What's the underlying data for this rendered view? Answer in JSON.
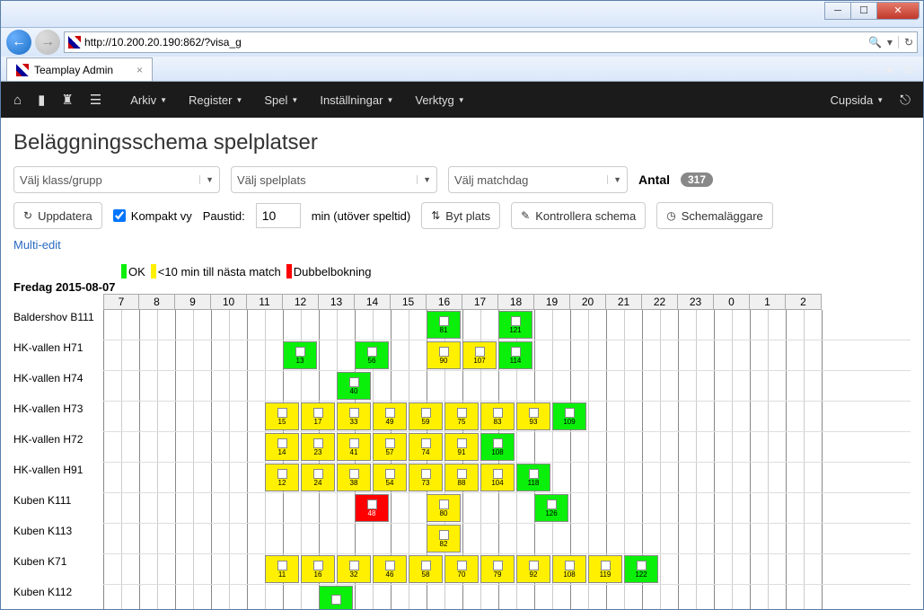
{
  "browser": {
    "url": "http://10.200.20.190:862/?visa_g",
    "tab_title": "Teamplay Admin"
  },
  "nav": {
    "items": [
      "Arkiv",
      "Register",
      "Spel",
      "Inställningar",
      "Verktyg"
    ],
    "right": "Cupsida"
  },
  "page_title": "Beläggningsschema spelplatser",
  "selects": {
    "klass": "Välj klass/grupp",
    "spelplats": "Välj spelplats",
    "matchdag": "Välj matchdag"
  },
  "antal_label": "Antal",
  "antal_value": "317",
  "btn_uppdatera": "Uppdatera",
  "chk_kompakt_label": "Kompakt vy",
  "paustid_label": "Paustid:",
  "paustid_value": "10",
  "paustid_suffix": "min (utöver speltid)",
  "btn_bytplats": "Byt plats",
  "btn_kontrollera": "Kontrollera schema",
  "btn_schemalaggare": "Schemaläggare",
  "link_multiedit": "Multi-edit",
  "legend": {
    "ok": "OK",
    "warn": "<10 min till nästa match",
    "err": "Dubbelbokning"
  },
  "date_label": "Fredag 2015-08-07",
  "hours": [
    "7",
    "8",
    "9",
    "10",
    "11",
    "12",
    "13",
    "14",
    "15",
    "16",
    "17",
    "18",
    "19",
    "20",
    "21",
    "22",
    "23",
    "0",
    "1",
    "2"
  ],
  "rows": [
    {
      "label": "Baldershov B111",
      "blocks": [
        {
          "start": 9,
          "color": "green",
          "num": "81"
        },
        {
          "start": 11,
          "color": "green",
          "num": "121"
        }
      ]
    },
    {
      "label": "HK-vallen H71",
      "blocks": [
        {
          "start": 5,
          "color": "green",
          "num": "13"
        },
        {
          "start": 7,
          "color": "green",
          "num": "56"
        },
        {
          "start": 9,
          "color": "yellow",
          "num": "90"
        },
        {
          "start": 10,
          "color": "yellow",
          "num": "107"
        },
        {
          "start": 11,
          "color": "green",
          "num": "114"
        }
      ]
    },
    {
      "label": "HK-vallen H74",
      "blocks": [
        {
          "start": 6.5,
          "color": "green",
          "num": "40"
        }
      ]
    },
    {
      "label": "HK-vallen H73",
      "blocks": [
        {
          "start": 4.5,
          "color": "yellow",
          "num": "15"
        },
        {
          "start": 5.5,
          "color": "yellow",
          "num": "17"
        },
        {
          "start": 6.5,
          "color": "yellow",
          "num": "33"
        },
        {
          "start": 7.5,
          "color": "yellow",
          "num": "49"
        },
        {
          "start": 8.5,
          "color": "yellow",
          "num": "59"
        },
        {
          "start": 9.5,
          "color": "yellow",
          "num": "75"
        },
        {
          "start": 10.5,
          "color": "yellow",
          "num": "83"
        },
        {
          "start": 11.5,
          "color": "yellow",
          "num": "93"
        },
        {
          "start": 12.5,
          "color": "green",
          "num": "109"
        }
      ]
    },
    {
      "label": "HK-vallen H72",
      "blocks": [
        {
          "start": 4.5,
          "color": "yellow",
          "num": "14"
        },
        {
          "start": 5.5,
          "color": "yellow",
          "num": "23"
        },
        {
          "start": 6.5,
          "color": "yellow",
          "num": "41"
        },
        {
          "start": 7.5,
          "color": "yellow",
          "num": "57"
        },
        {
          "start": 8.5,
          "color": "yellow",
          "num": "74"
        },
        {
          "start": 9.5,
          "color": "yellow",
          "num": "91"
        },
        {
          "start": 10.5,
          "color": "green",
          "num": "108"
        }
      ]
    },
    {
      "label": "HK-vallen H91",
      "blocks": [
        {
          "start": 4.5,
          "color": "yellow",
          "num": "12"
        },
        {
          "start": 5.5,
          "color": "yellow",
          "num": "24"
        },
        {
          "start": 6.5,
          "color": "yellow",
          "num": "38"
        },
        {
          "start": 7.5,
          "color": "yellow",
          "num": "54"
        },
        {
          "start": 8.5,
          "color": "yellow",
          "num": "73"
        },
        {
          "start": 9.5,
          "color": "yellow",
          "num": "88"
        },
        {
          "start": 10.5,
          "color": "yellow",
          "num": "104"
        },
        {
          "start": 11.5,
          "color": "green",
          "num": "118"
        }
      ]
    },
    {
      "label": "Kuben K111",
      "blocks": [
        {
          "start": 7,
          "color": "red",
          "num": "48"
        },
        {
          "start": 9,
          "color": "yellow",
          "num": "80"
        },
        {
          "start": 12,
          "color": "green",
          "num": "126"
        }
      ]
    },
    {
      "label": "Kuben K113",
      "blocks": [
        {
          "start": 9,
          "color": "yellow",
          "num": "82"
        }
      ]
    },
    {
      "label": "Kuben K71",
      "blocks": [
        {
          "start": 4.5,
          "color": "yellow",
          "num": "11"
        },
        {
          "start": 5.5,
          "color": "yellow",
          "num": "16"
        },
        {
          "start": 6.5,
          "color": "yellow",
          "num": "32"
        },
        {
          "start": 7.5,
          "color": "yellow",
          "num": "46"
        },
        {
          "start": 8.5,
          "color": "yellow",
          "num": "58"
        },
        {
          "start": 9.5,
          "color": "yellow",
          "num": "70"
        },
        {
          "start": 10.5,
          "color": "yellow",
          "num": "79"
        },
        {
          "start": 11.5,
          "color": "yellow",
          "num": "92"
        },
        {
          "start": 12.5,
          "color": "yellow",
          "num": "108"
        },
        {
          "start": 13.5,
          "color": "yellow",
          "num": "119"
        },
        {
          "start": 14.5,
          "color": "green",
          "num": "122"
        }
      ]
    },
    {
      "label": "Kuben K112",
      "blocks": [
        {
          "start": 6,
          "color": "green",
          "num": ""
        }
      ]
    }
  ]
}
